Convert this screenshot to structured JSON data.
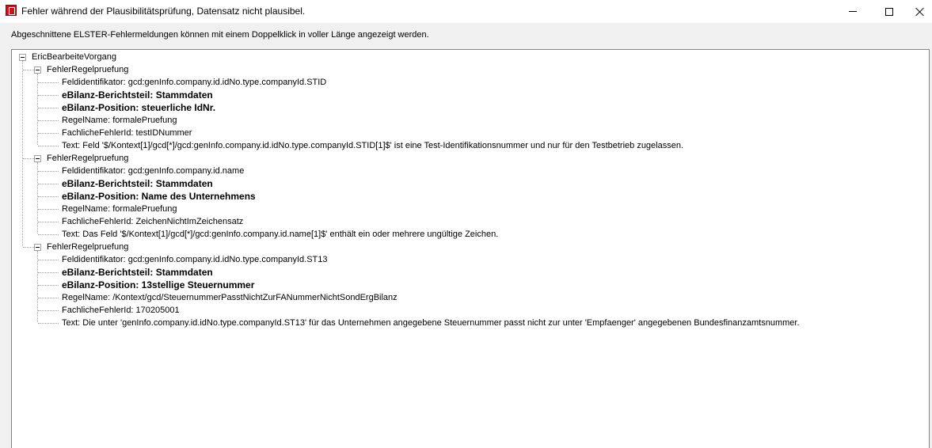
{
  "window": {
    "title": "Fehler während der Plausibilitätsprüfung, Datensatz nicht plausibel.",
    "icon": "elster-app-icon"
  },
  "hint": "Abgeschnittene ELSTER-Fehlermeldungen können mit einem Doppelklick in voller Länge angezeigt werden.",
  "tree": {
    "root": "EricBearbeiteVorgang",
    "groups": [
      {
        "label": "FehlerRegelpruefung",
        "items": [
          "Feldidentifikator: gcd:genInfo.company.id.idNo.type.companyId.STID",
          "eBilanz-Berichtsteil: Stammdaten",
          "eBilanz-Position: steuerliche IdNr.",
          "RegelName: formalePruefung",
          "FachlicheFehlerId: testIDNummer",
          "Text: Feld '$/Kontext[1]/gcd[*]/gcd:genInfo.company.id.idNo.type.companyId.STID[1]$' ist eine Test-Identifikationsnummer und nur für den Testbetrieb zugelassen."
        ]
      },
      {
        "label": "FehlerRegelpruefung",
        "items": [
          "Feldidentifikator: gcd:genInfo.company.id.name",
          "eBilanz-Berichtsteil: Stammdaten",
          "eBilanz-Position: Name des Unternehmens",
          "RegelName: formalePruefung",
          "FachlicheFehlerId: ZeichenNichtImZeichensatz",
          "Text: Das Feld '$/Kontext[1]/gcd[*]/gcd:genInfo.company.id.name[1]$' enthält ein oder mehrere ungültige Zeichen."
        ]
      },
      {
        "label": "FehlerRegelpruefung",
        "items": [
          "Feldidentifikator: gcd:genInfo.company.id.idNo.type.companyId.ST13",
          "eBilanz-Berichtsteil: Stammdaten",
          "eBilanz-Position: 13stellige Steuernummer",
          "RegelName: /Kontext/gcd/SteuernummerPasstNichtZurFANummerNichtSondErgBilanz",
          "FachlicheFehlerId: 170205001",
          "Text: Die unter 'genInfo.company.id.idNo.type.companyId.ST13' für das Unternehmen angegebene Steuernummer passt nicht zur unter 'Empfaenger' angegebenen Bundesfinanzamtsnummer."
        ]
      }
    ]
  }
}
